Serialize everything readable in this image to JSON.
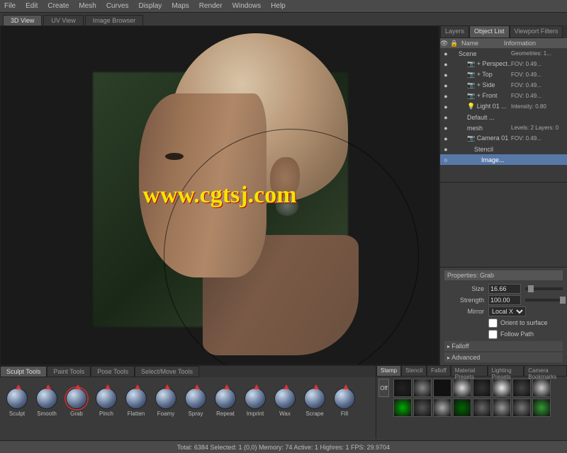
{
  "menu": {
    "file": "File",
    "edit": "Edit",
    "create": "Create",
    "mesh": "Mesh",
    "curves": "Curves",
    "display": "Display",
    "maps": "Maps",
    "render": "Render",
    "windows": "Windows",
    "help": "Help"
  },
  "viewtabs": {
    "t3d": "3D View",
    "uv": "UV View",
    "img": "Image Browser"
  },
  "watermark": "www.cgtsj.com",
  "rtabs": {
    "layers": "Layers",
    "objlist": "Object List",
    "vpf": "Viewport Filters"
  },
  "listhdr": {
    "name": "Name",
    "info": "Information"
  },
  "objects": [
    {
      "vis": "●",
      "name": "Scene",
      "info": "Geometries: 1...",
      "ind": 0
    },
    {
      "vis": "●",
      "name": "+ Perspect...",
      "info": "FOV: 0.49...",
      "ind": 1,
      "cam": true
    },
    {
      "vis": "●",
      "name": "+ Top",
      "info": "FOV: 0.49...",
      "ind": 1,
      "cam": true
    },
    {
      "vis": "●",
      "name": "+ Side",
      "info": "FOV: 0.49...",
      "ind": 1,
      "cam": true
    },
    {
      "vis": "●",
      "name": "+ Front",
      "info": "FOV: 0.49...",
      "ind": 1,
      "cam": true
    },
    {
      "vis": "●",
      "name": "Light 01 ...",
      "info": "Intensity: 0.80",
      "ind": 1,
      "light": true
    },
    {
      "vis": "●",
      "name": "Default ...",
      "info": "",
      "ind": 1
    },
    {
      "vis": "●",
      "name": "mesh",
      "info": "Levels: 2        Layers: 0",
      "ind": 1
    },
    {
      "vis": "●",
      "name": "Camera 01",
      "info": "FOV: 0.49...",
      "ind": 1,
      "cam": true
    },
    {
      "vis": "●",
      "name": "Stencil",
      "info": "",
      "ind": 2
    },
    {
      "vis": "○",
      "name": "Image...",
      "info": "",
      "ind": 3,
      "sel": true
    }
  ],
  "props": {
    "title": "Properties: Grab",
    "size_label": "Size",
    "size": "16.66",
    "strength_label": "Strength",
    "strength": "100.00",
    "mirror_label": "Mirror",
    "mirror": "Local X",
    "orient_label": "Orient to surface",
    "falloff_label": "Follow Path",
    "sec1": "Falloff",
    "sec2": "Advanced"
  },
  "tooltabs": {
    "sculpt": "Sculpt Tools",
    "paint": "Paint Tools",
    "pose": "Pose Tools",
    "sel": "Select/Move Tools"
  },
  "tools": [
    "Sculpt",
    "Smooth",
    "Grab",
    "Pinch",
    "Flatten",
    "Foamy",
    "Spray",
    "Repeat",
    "Imprint",
    "Wax",
    "Scrape",
    "Fill"
  ],
  "tool_selected": "Grab",
  "rbt": {
    "stamp": "Stamp",
    "stencil": "Stencil",
    "falloff": "Falloff",
    "mat": "Material Presets",
    "light": "Lighting Presets",
    "cam": "Camera Bookmarks",
    "off": "Off"
  },
  "status": "Total: 6384  Selected: 1 (0,0)  Memory: 74  Active: 1  Highres: 1   FPS: 29.9704"
}
